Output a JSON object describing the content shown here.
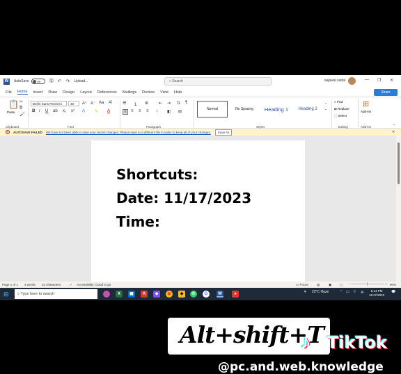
{
  "titlebar": {
    "autosave_label": "AutoSave",
    "autosave_state": "Off",
    "upload_label": "Upload...",
    "search_placeholder": "Search",
    "user_name": "sajawal sattar"
  },
  "menu": {
    "tabs": [
      "File",
      "Home",
      "Insert",
      "Draw",
      "Design",
      "Layout",
      "References",
      "Mailings",
      "Review",
      "View",
      "Help"
    ],
    "active_tab": "Home",
    "share_label": "Share"
  },
  "ribbon": {
    "clipboard": {
      "paste_label": "Paste",
      "group_label": "Clipboard"
    },
    "font": {
      "font_name": "Berlin Sans FB Demi",
      "font_size": "48",
      "group_label": "Font"
    },
    "paragraph": {
      "group_label": "Paragraph"
    },
    "styles": {
      "items": [
        "Normal",
        "No Spacing",
        "Heading 1",
        "Heading 2"
      ],
      "group_label": "Styles"
    },
    "editing": {
      "find_label": "Find",
      "replace_label": "Replace",
      "select_label": "Select",
      "group_label": "Editing"
    },
    "addins": {
      "button_label": "Add-ins",
      "group_label": "Add-ins"
    }
  },
  "notification": {
    "title": "AUTOSAVE FAILED",
    "message": "We have not been able to save your recent changes. Please save to a different file in order to keep all of your changes.",
    "save_as_label": "Save As"
  },
  "document": {
    "lines": [
      "Shortcuts:",
      "Date: 11/17/2023",
      "Time:"
    ]
  },
  "statusbar": {
    "page": "Page 1 of 1",
    "words": "4 words",
    "characters": "32 characters",
    "accessibility": "Accessibility: Good to go",
    "focus_label": "Focus",
    "zoom": "90%"
  },
  "taskbar": {
    "search_placeholder": "Type here to search",
    "weather": "22°C  Haze",
    "time": "6:14 PM",
    "date": "11/17/2023"
  },
  "overlay": {
    "shortcut_text": "Alt+shift+T",
    "brand": "TikTok",
    "handle": "@pc.and.web.knowledge"
  }
}
